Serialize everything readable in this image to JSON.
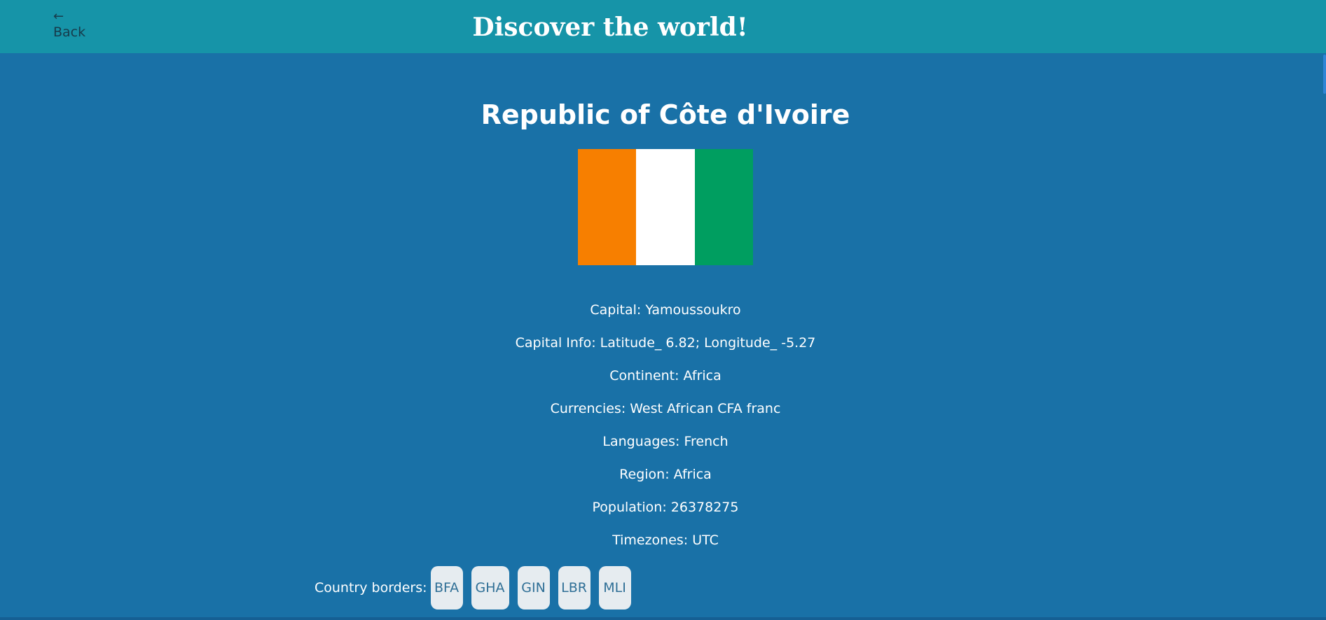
{
  "header": {
    "back_arrow": "←",
    "back_label": "Back",
    "title": "Discover the world!"
  },
  "country": {
    "name": "Republic of Côte d'Ivoire",
    "flag_colors": [
      "#f77f00",
      "#ffffff",
      "#009e60"
    ],
    "capital": "Capital: Yamoussoukro",
    "capital_info": "Capital Info: Latitude_ 6.82; Longitude_ -5.27",
    "continent": "Continent: Africa",
    "currencies": "Currencies: West African CFA franc",
    "languages": "Languages: French",
    "region": "Region: Africa",
    "population": "Population: 26378275",
    "timezones": "Timezones: UTC"
  },
  "borders": {
    "label": "Country borders:",
    "codes": [
      "BFA",
      "GHA",
      "GIN",
      "LBR",
      "MLI"
    ]
  },
  "colors": {
    "header_bg": "#1694a8",
    "page_bg": "#1971a7",
    "button_bg": "#e6ecf0",
    "button_text": "#2f6f96"
  }
}
